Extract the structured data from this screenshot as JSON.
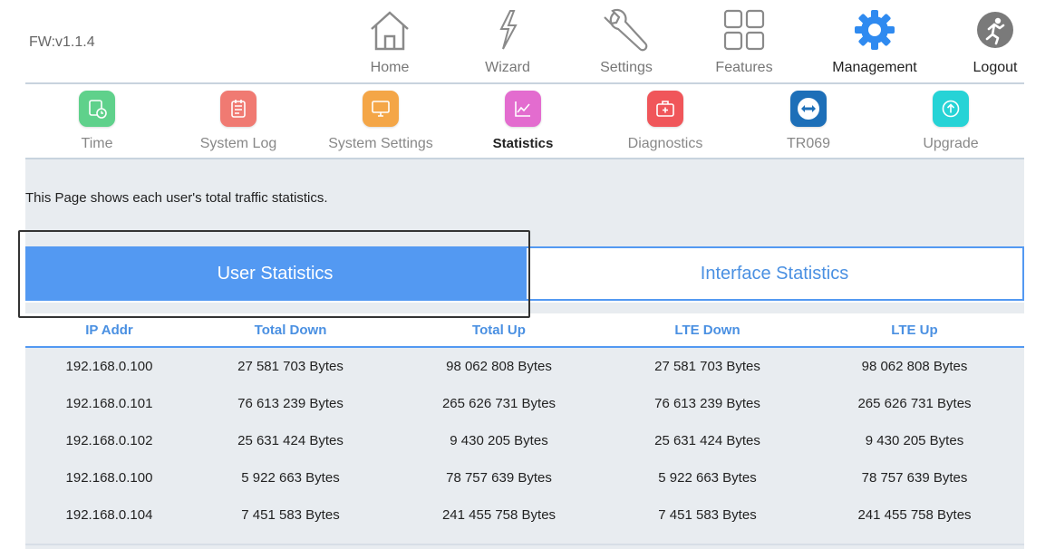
{
  "header": {
    "firmware": "FW:v1.1.4"
  },
  "topnav": {
    "items": [
      {
        "label": "Home",
        "icon": "home-icon"
      },
      {
        "label": "Wizard",
        "icon": "wizard-icon"
      },
      {
        "label": "Settings",
        "icon": "wrench-icon"
      },
      {
        "label": "Features",
        "icon": "grid-icon"
      },
      {
        "label": "Management",
        "icon": "gear-icon"
      },
      {
        "label": "Logout",
        "icon": "logout-icon"
      }
    ],
    "active": "Management"
  },
  "subnav": {
    "items": [
      {
        "label": "Time",
        "icon": "time-icon",
        "color": "#5fd18b"
      },
      {
        "label": "System Log",
        "icon": "log-icon",
        "color": "#f07a72"
      },
      {
        "label": "System Settings",
        "icon": "monitor-icon",
        "color": "#f4a647"
      },
      {
        "label": "Statistics",
        "icon": "chart-icon",
        "color": "#e36ccf"
      },
      {
        "label": "Diagnostics",
        "icon": "medkit-icon",
        "color": "#f0565a"
      },
      {
        "label": "TR069",
        "icon": "tr069-icon",
        "color": "#1d6fb8"
      },
      {
        "label": "Upgrade",
        "icon": "upgrade-icon",
        "color": "#26d3d6"
      }
    ],
    "active": "Statistics"
  },
  "main": {
    "description": "This Page shows each user's total traffic statistics.",
    "tabs": [
      {
        "label": "User Statistics"
      },
      {
        "label": "Interface Statistics"
      }
    ],
    "table": {
      "headers": [
        "IP Addr",
        "Total Down",
        "Total Up",
        "LTE Down",
        "LTE Up"
      ],
      "rows": [
        [
          "192.168.0.100",
          "27 581 703 Bytes",
          "98 062 808 Bytes",
          "27 581 703 Bytes",
          "98 062 808 Bytes"
        ],
        [
          "192.168.0.101",
          "76 613 239 Bytes",
          "265 626 731 Bytes",
          "76 613 239 Bytes",
          "265 626 731 Bytes"
        ],
        [
          "192.168.0.102",
          "25 631 424 Bytes",
          "9 430 205 Bytes",
          "25 631 424 Bytes",
          "9 430 205 Bytes"
        ],
        [
          "192.168.0.100",
          "5 922 663 Bytes",
          "78 757 639 Bytes",
          "5 922 663 Bytes",
          "78 757 639 Bytes"
        ],
        [
          "192.168.0.104",
          "7 451 583 Bytes",
          "241 455 758 Bytes",
          "7 451 583 Bytes",
          "241 455 758 Bytes"
        ]
      ]
    }
  },
  "colors": {
    "accent": "#5399f2",
    "header_text": "#4a90e2",
    "content_bg": "#e8ecf0"
  }
}
